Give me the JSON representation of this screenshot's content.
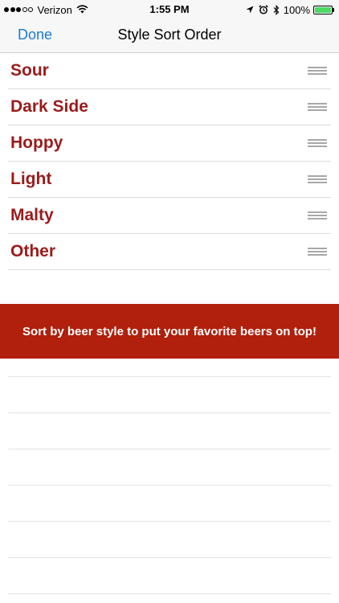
{
  "status_bar": {
    "carrier": "Verizon",
    "time": "1:55 PM",
    "battery_percent": "100%",
    "battery_level": 1.0,
    "signal_bars_filled": 3,
    "signal_bars_total": 5,
    "icons": [
      "wifi-icon",
      "location-arrow-icon",
      "alarm-clock-icon",
      "bluetooth-icon",
      "battery-icon"
    ]
  },
  "nav": {
    "done_label": "Done",
    "title": "Style Sort Order"
  },
  "styles": [
    {
      "label": "Sour"
    },
    {
      "label": "Dark Side"
    },
    {
      "label": "Hoppy"
    },
    {
      "label": "Light"
    },
    {
      "label": "Malty"
    },
    {
      "label": "Other"
    }
  ],
  "banner": {
    "text": "Sort by beer style to put your favorite beers on top!"
  },
  "colors": {
    "accent_blue": "#1a7bd6",
    "style_label": "#9b1b1b",
    "banner_bg": "#b0200c",
    "battery_green": "#4cd964"
  }
}
